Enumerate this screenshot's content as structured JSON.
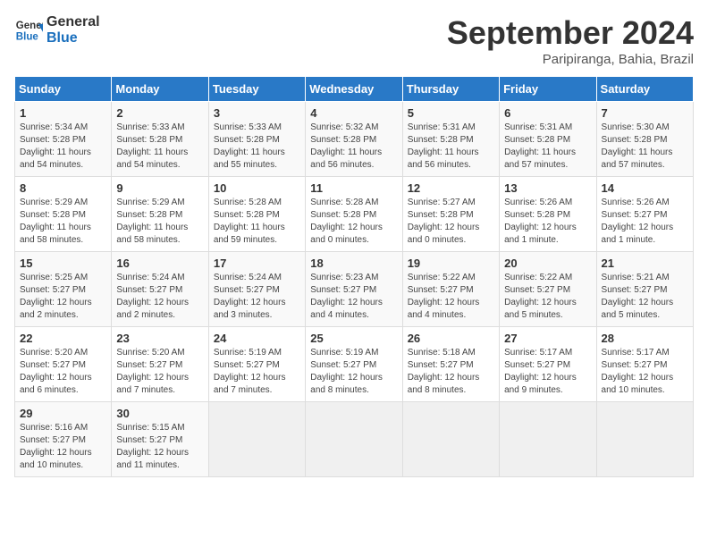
{
  "header": {
    "logo_line1": "General",
    "logo_line2": "Blue",
    "month": "September 2024",
    "location": "Paripiranga, Bahia, Brazil"
  },
  "days_of_week": [
    "Sunday",
    "Monday",
    "Tuesday",
    "Wednesday",
    "Thursday",
    "Friday",
    "Saturday"
  ],
  "weeks": [
    [
      {
        "day": "1",
        "info": "Sunrise: 5:34 AM\nSunset: 5:28 PM\nDaylight: 11 hours\nand 54 minutes."
      },
      {
        "day": "2",
        "info": "Sunrise: 5:33 AM\nSunset: 5:28 PM\nDaylight: 11 hours\nand 54 minutes."
      },
      {
        "day": "3",
        "info": "Sunrise: 5:33 AM\nSunset: 5:28 PM\nDaylight: 11 hours\nand 55 minutes."
      },
      {
        "day": "4",
        "info": "Sunrise: 5:32 AM\nSunset: 5:28 PM\nDaylight: 11 hours\nand 56 minutes."
      },
      {
        "day": "5",
        "info": "Sunrise: 5:31 AM\nSunset: 5:28 PM\nDaylight: 11 hours\nand 56 minutes."
      },
      {
        "day": "6",
        "info": "Sunrise: 5:31 AM\nSunset: 5:28 PM\nDaylight: 11 hours\nand 57 minutes."
      },
      {
        "day": "7",
        "info": "Sunrise: 5:30 AM\nSunset: 5:28 PM\nDaylight: 11 hours\nand 57 minutes."
      }
    ],
    [
      {
        "day": "8",
        "info": "Sunrise: 5:29 AM\nSunset: 5:28 PM\nDaylight: 11 hours\nand 58 minutes."
      },
      {
        "day": "9",
        "info": "Sunrise: 5:29 AM\nSunset: 5:28 PM\nDaylight: 11 hours\nand 58 minutes."
      },
      {
        "day": "10",
        "info": "Sunrise: 5:28 AM\nSunset: 5:28 PM\nDaylight: 11 hours\nand 59 minutes."
      },
      {
        "day": "11",
        "info": "Sunrise: 5:28 AM\nSunset: 5:28 PM\nDaylight: 12 hours\nand 0 minutes."
      },
      {
        "day": "12",
        "info": "Sunrise: 5:27 AM\nSunset: 5:28 PM\nDaylight: 12 hours\nand 0 minutes."
      },
      {
        "day": "13",
        "info": "Sunrise: 5:26 AM\nSunset: 5:28 PM\nDaylight: 12 hours\nand 1 minute."
      },
      {
        "day": "14",
        "info": "Sunrise: 5:26 AM\nSunset: 5:27 PM\nDaylight: 12 hours\nand 1 minute."
      }
    ],
    [
      {
        "day": "15",
        "info": "Sunrise: 5:25 AM\nSunset: 5:27 PM\nDaylight: 12 hours\nand 2 minutes."
      },
      {
        "day": "16",
        "info": "Sunrise: 5:24 AM\nSunset: 5:27 PM\nDaylight: 12 hours\nand 2 minutes."
      },
      {
        "day": "17",
        "info": "Sunrise: 5:24 AM\nSunset: 5:27 PM\nDaylight: 12 hours\nand 3 minutes."
      },
      {
        "day": "18",
        "info": "Sunrise: 5:23 AM\nSunset: 5:27 PM\nDaylight: 12 hours\nand 4 minutes."
      },
      {
        "day": "19",
        "info": "Sunrise: 5:22 AM\nSunset: 5:27 PM\nDaylight: 12 hours\nand 4 minutes."
      },
      {
        "day": "20",
        "info": "Sunrise: 5:22 AM\nSunset: 5:27 PM\nDaylight: 12 hours\nand 5 minutes."
      },
      {
        "day": "21",
        "info": "Sunrise: 5:21 AM\nSunset: 5:27 PM\nDaylight: 12 hours\nand 5 minutes."
      }
    ],
    [
      {
        "day": "22",
        "info": "Sunrise: 5:20 AM\nSunset: 5:27 PM\nDaylight: 12 hours\nand 6 minutes."
      },
      {
        "day": "23",
        "info": "Sunrise: 5:20 AM\nSunset: 5:27 PM\nDaylight: 12 hours\nand 7 minutes."
      },
      {
        "day": "24",
        "info": "Sunrise: 5:19 AM\nSunset: 5:27 PM\nDaylight: 12 hours\nand 7 minutes."
      },
      {
        "day": "25",
        "info": "Sunrise: 5:19 AM\nSunset: 5:27 PM\nDaylight: 12 hours\nand 8 minutes."
      },
      {
        "day": "26",
        "info": "Sunrise: 5:18 AM\nSunset: 5:27 PM\nDaylight: 12 hours\nand 8 minutes."
      },
      {
        "day": "27",
        "info": "Sunrise: 5:17 AM\nSunset: 5:27 PM\nDaylight: 12 hours\nand 9 minutes."
      },
      {
        "day": "28",
        "info": "Sunrise: 5:17 AM\nSunset: 5:27 PM\nDaylight: 12 hours\nand 10 minutes."
      }
    ],
    [
      {
        "day": "29",
        "info": "Sunrise: 5:16 AM\nSunset: 5:27 PM\nDaylight: 12 hours\nand 10 minutes."
      },
      {
        "day": "30",
        "info": "Sunrise: 5:15 AM\nSunset: 5:27 PM\nDaylight: 12 hours\nand 11 minutes."
      },
      {
        "day": "",
        "info": ""
      },
      {
        "day": "",
        "info": ""
      },
      {
        "day": "",
        "info": ""
      },
      {
        "day": "",
        "info": ""
      },
      {
        "day": "",
        "info": ""
      }
    ]
  ]
}
